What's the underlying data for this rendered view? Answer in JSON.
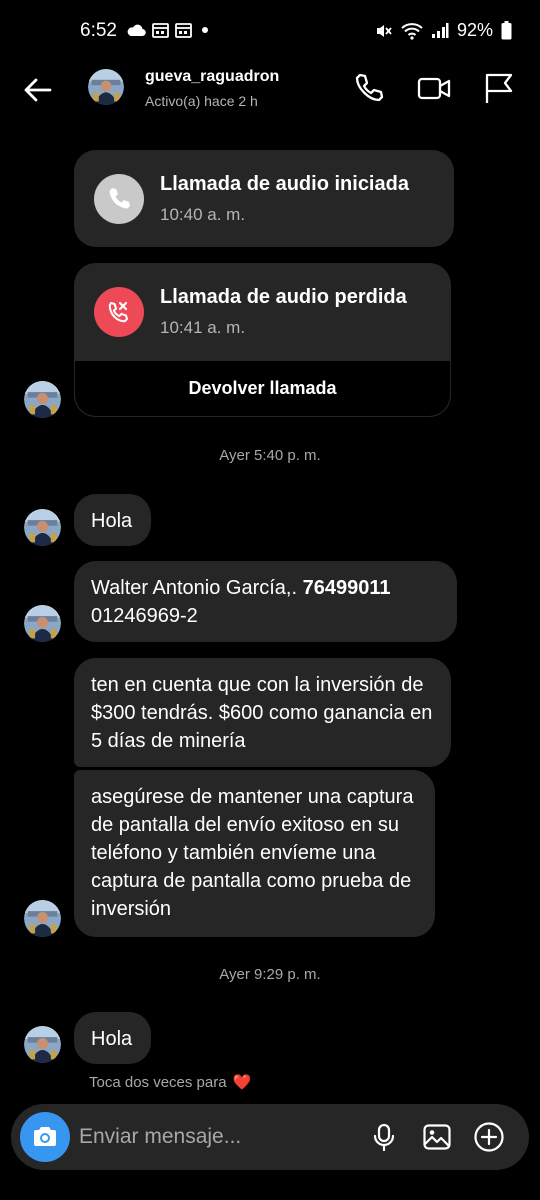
{
  "status_bar": {
    "time": "6:52",
    "battery": "92%"
  },
  "header": {
    "username": "gueva_raguadron",
    "status": "Activo(a) hace 2 h"
  },
  "calls": [
    {
      "title": "Llamada de audio iniciada",
      "time": "10:40 a. m."
    },
    {
      "title": "Llamada de audio perdida",
      "time": "10:41 a. m.",
      "action": "Devolver llamada"
    }
  ],
  "timestamps": [
    "Ayer 5:40 p. m.",
    "Ayer 9:29 p. m."
  ],
  "messages": {
    "m1": "Hola",
    "m2_name": "Walter Antonio García,.",
    "m2_number": "76499011",
    "m2_line2": "01246969-2",
    "m3": "ten en cuenta que con la inversión de $300 tendrás.  $600 como ganancia en 5 días de minería",
    "m4": "asegúrese de mantener una captura de pantalla del envío exitoso en su teléfono y también envíeme una captura de pantalla como prueba de inversión",
    "m5": "Hola"
  },
  "hint": {
    "text": "Toca dos veces para",
    "emoji": "❤️"
  },
  "composer": {
    "placeholder": "Enviar mensaje..."
  },
  "colors": {
    "accent": "#3797f0",
    "missed": "#ed4956",
    "bubble": "#262626"
  }
}
